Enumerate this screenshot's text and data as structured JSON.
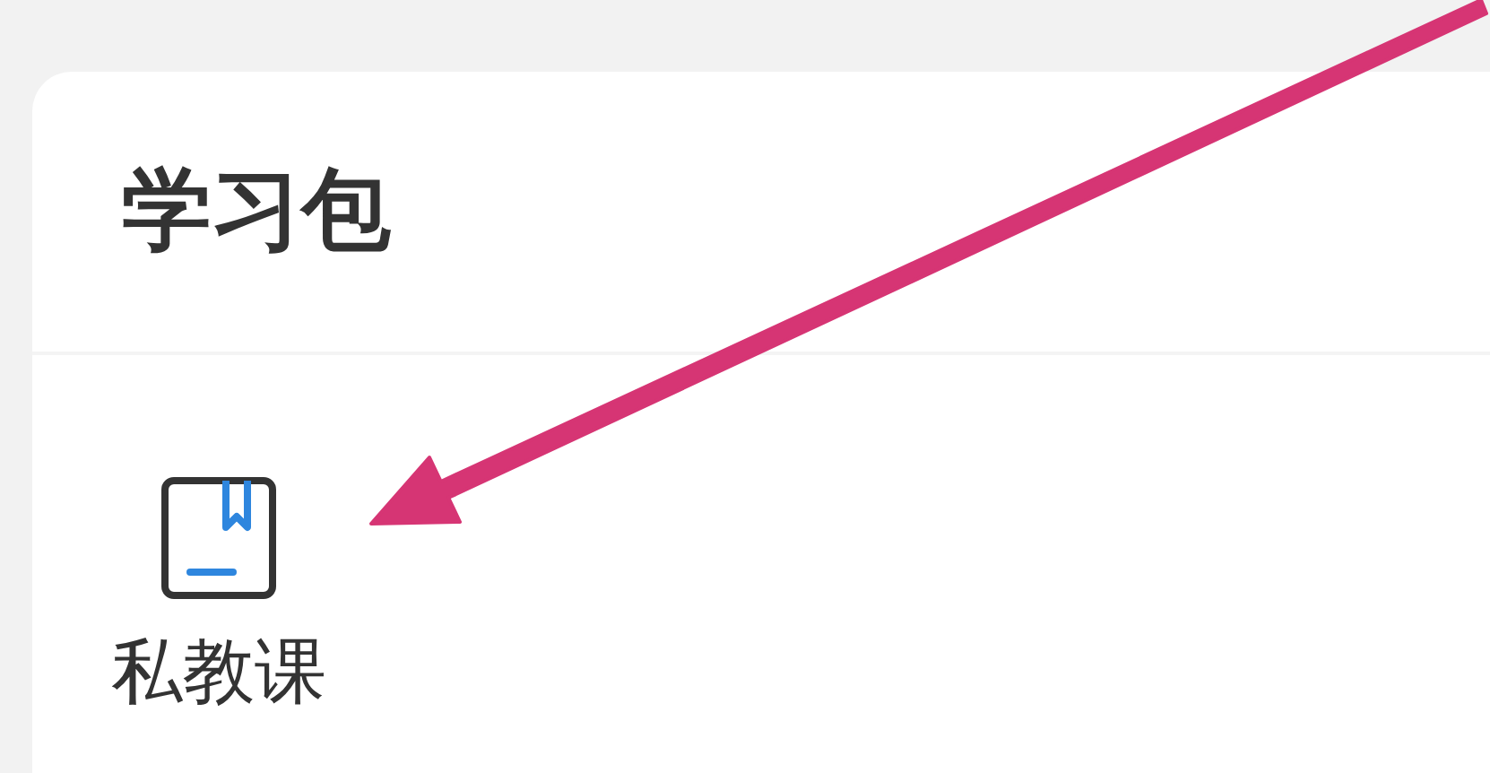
{
  "card": {
    "title": "学习包",
    "items": [
      {
        "label": "私教课",
        "kind": "book"
      }
    ]
  }
}
